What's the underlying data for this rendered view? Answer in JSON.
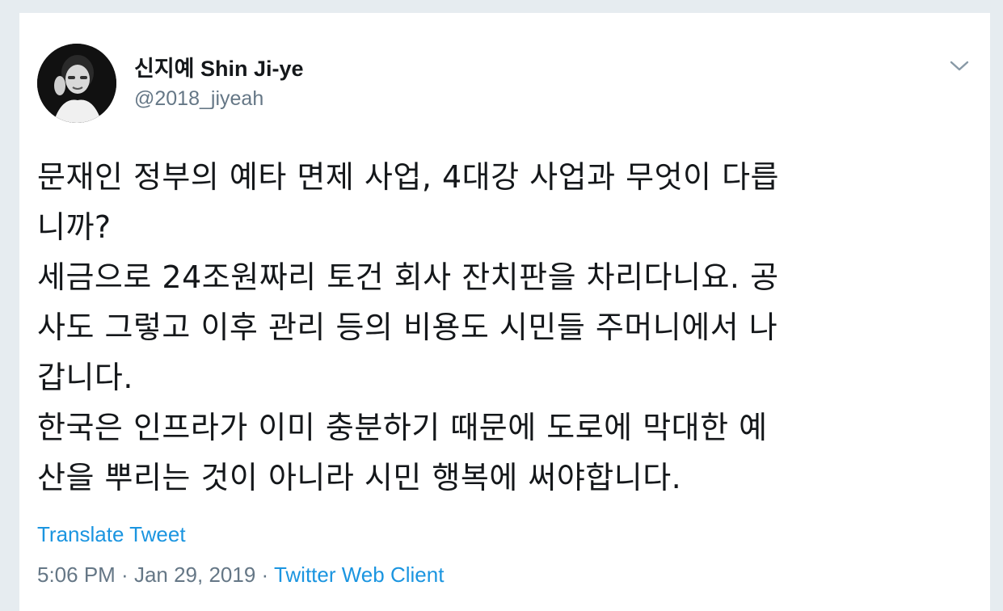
{
  "author": {
    "display_name": "신지예 Shin Ji-ye",
    "handle": "@2018_jiyeah"
  },
  "icons": {
    "caret": "chevron-down-icon",
    "avatar": "profile-photo"
  },
  "tweet": {
    "lines": [
      "문재인 정부의 예타 면제 사업, 4대강 사업과 무엇이 다릅",
      "니까?",
      "세금으로 24조원짜리 토건 회사 잔치판을 차리다니요. 공",
      "사도 그렇고 이후 관리 등의 비용도 시민들 주머니에서 나",
      "갑니다.",
      "한국은 인프라가 이미 충분하기 때문에 도로에 막대한 예",
      "산을 뿌리는 것이 아니라 시민 행복에 써야합니다."
    ]
  },
  "translate_label": "Translate Tweet",
  "meta": {
    "time": "5:06 PM",
    "separator": " · ",
    "date": "Jan 29, 2019",
    "client": "Twitter Web Client"
  },
  "colors": {
    "background": "#e6ecf0",
    "link": "#1b95e0",
    "secondary_text": "#657786",
    "primary_text": "#14171a"
  }
}
